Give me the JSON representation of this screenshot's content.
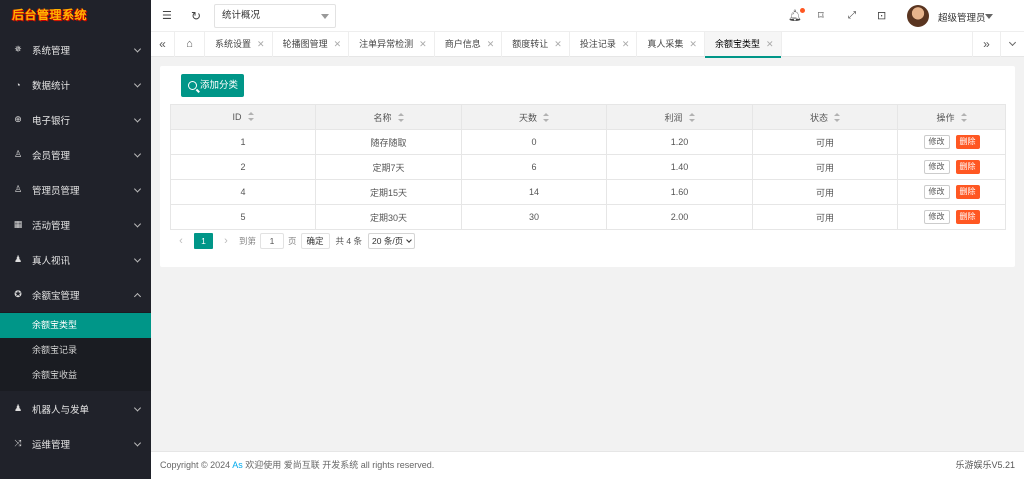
{
  "app": {
    "logo": "后台管理系统"
  },
  "sidebar": {
    "items": [
      {
        "label": "系统管理",
        "icon": "gear-icon",
        "glyph": "✵"
      },
      {
        "label": "数据统计",
        "icon": "gauge-icon",
        "glyph": "◔"
      },
      {
        "label": "电子银行",
        "icon": "coin-icon",
        "glyph": "⊕"
      },
      {
        "label": "会员管理",
        "icon": "users-icon",
        "glyph": "♙"
      },
      {
        "label": "管理员管理",
        "icon": "user-icon",
        "glyph": "♙"
      },
      {
        "label": "活动管理",
        "icon": "calendar-icon",
        "glyph": "▦"
      },
      {
        "label": "真人视讯",
        "icon": "group-icon",
        "glyph": "♟"
      },
      {
        "label": "余额宝管理",
        "icon": "settings-icon",
        "glyph": "✪"
      },
      {
        "label": "机器人与发单",
        "icon": "robot-user-icon",
        "glyph": "♟"
      },
      {
        "label": "运维管理",
        "icon": "shuffle-icon",
        "glyph": "⤨"
      }
    ],
    "sub_items": [
      {
        "label": "余额宝类型"
      },
      {
        "label": "余额宝记录"
      },
      {
        "label": "余额宝收益"
      }
    ]
  },
  "header": {
    "select_value": "统计概况",
    "user_name": "超级管理员"
  },
  "tabs": [
    {
      "label": "系统设置"
    },
    {
      "label": "轮播图管理"
    },
    {
      "label": "注单异常检测"
    },
    {
      "label": "商户信息"
    },
    {
      "label": "额度转让"
    },
    {
      "label": "投注记录"
    },
    {
      "label": "真人采集"
    },
    {
      "label": "余额宝类型"
    }
  ],
  "toolbar": {
    "add_label": "添加分类"
  },
  "table": {
    "columns": [
      "ID",
      "名称",
      "天数",
      "利润",
      "状态",
      "操作"
    ],
    "rows": [
      {
        "id": "1",
        "name": "随存随取",
        "days": "0",
        "profit": "1.20",
        "status": "可用"
      },
      {
        "id": "2",
        "name": "定期7天",
        "days": "6",
        "profit": "1.40",
        "status": "可用"
      },
      {
        "id": "4",
        "name": "定期15天",
        "days": "14",
        "profit": "1.60",
        "status": "可用"
      },
      {
        "id": "5",
        "name": "定期30天",
        "days": "30",
        "profit": "2.00",
        "status": "可用"
      }
    ],
    "edit_label": "修改",
    "delete_label": "删除"
  },
  "pager": {
    "current": "1",
    "goto_label": "到第",
    "goto_value": "1",
    "page_label": "页",
    "confirm_label": "确定",
    "total_label": "共 4 条",
    "page_size": "20 条/页"
  },
  "footer": {
    "copyright_prefix": "Copyright © 2024 ",
    "link": "As",
    "copyright_suffix": " 欢迎使用 爱尚互联 开发系统 all rights reserved.",
    "version": "乐游娱乐V5.21"
  },
  "colors": {
    "accent": "#009688",
    "danger": "#ff5722",
    "sidebar": "#20222a"
  }
}
